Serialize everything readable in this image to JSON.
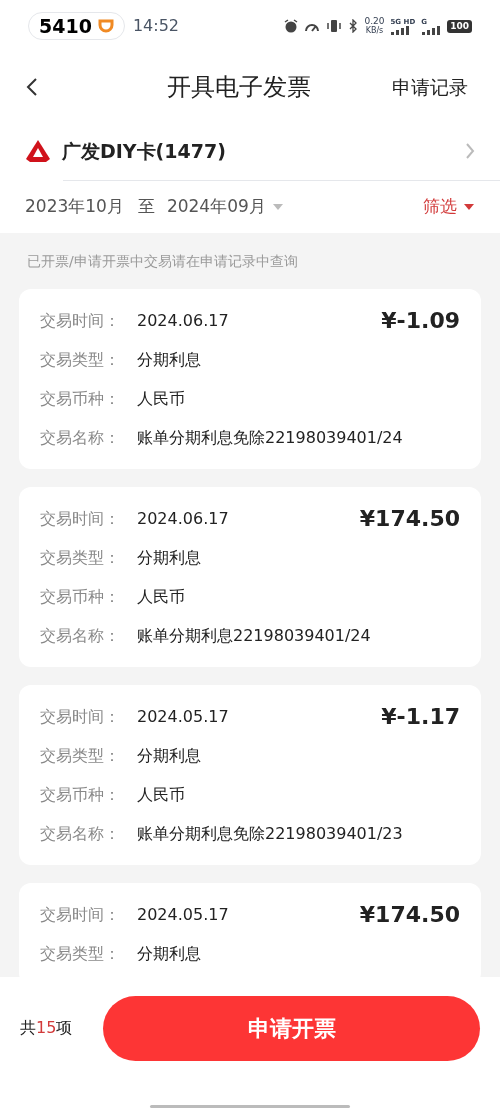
{
  "status_bar": {
    "badge_number": "5410",
    "time": "14:52",
    "net_speed": "0.20",
    "net_unit": "KB/s",
    "sim1_label": "5G HD",
    "sim2_label": "G",
    "battery": "100"
  },
  "header": {
    "title": "开具电子发票",
    "action": "申请记录"
  },
  "card_selector": {
    "name": "广发DIY卡(1477)"
  },
  "filter_bar": {
    "start": "2023年10月",
    "separator": "至",
    "end": "2024年09月",
    "filter": "筛选"
  },
  "notice": "已开票/申请开票中交易请在申请记录中查询",
  "transactions": [
    {
      "amount": "¥-1.09",
      "fields": [
        {
          "label": "交易时间：",
          "value": "2024.06.17"
        },
        {
          "label": "交易类型：",
          "value": "分期利息"
        },
        {
          "label": "交易币种：",
          "value": "人民币"
        },
        {
          "label": "交易名称：",
          "value": "账单分期利息免除22198039401/24"
        }
      ]
    },
    {
      "amount": "¥174.50",
      "fields": [
        {
          "label": "交易时间：",
          "value": "2024.06.17"
        },
        {
          "label": "交易类型：",
          "value": "分期利息"
        },
        {
          "label": "交易币种：",
          "value": "人民币"
        },
        {
          "label": "交易名称：",
          "value": "账单分期利息22198039401/24"
        }
      ]
    },
    {
      "amount": "¥-1.17",
      "fields": [
        {
          "label": "交易时间：",
          "value": "2024.05.17"
        },
        {
          "label": "交易类型：",
          "value": "分期利息"
        },
        {
          "label": "交易币种：",
          "value": "人民币"
        },
        {
          "label": "交易名称：",
          "value": "账单分期利息免除22198039401/23"
        }
      ]
    },
    {
      "amount": "¥174.50",
      "fields": [
        {
          "label": "交易时间：",
          "value": "2024.05.17"
        },
        {
          "label": "交易类型：",
          "value": "分期利息"
        }
      ]
    }
  ],
  "footer": {
    "count_prefix": "共",
    "count": "15",
    "count_suffix": "项",
    "button": "申请开票"
  }
}
